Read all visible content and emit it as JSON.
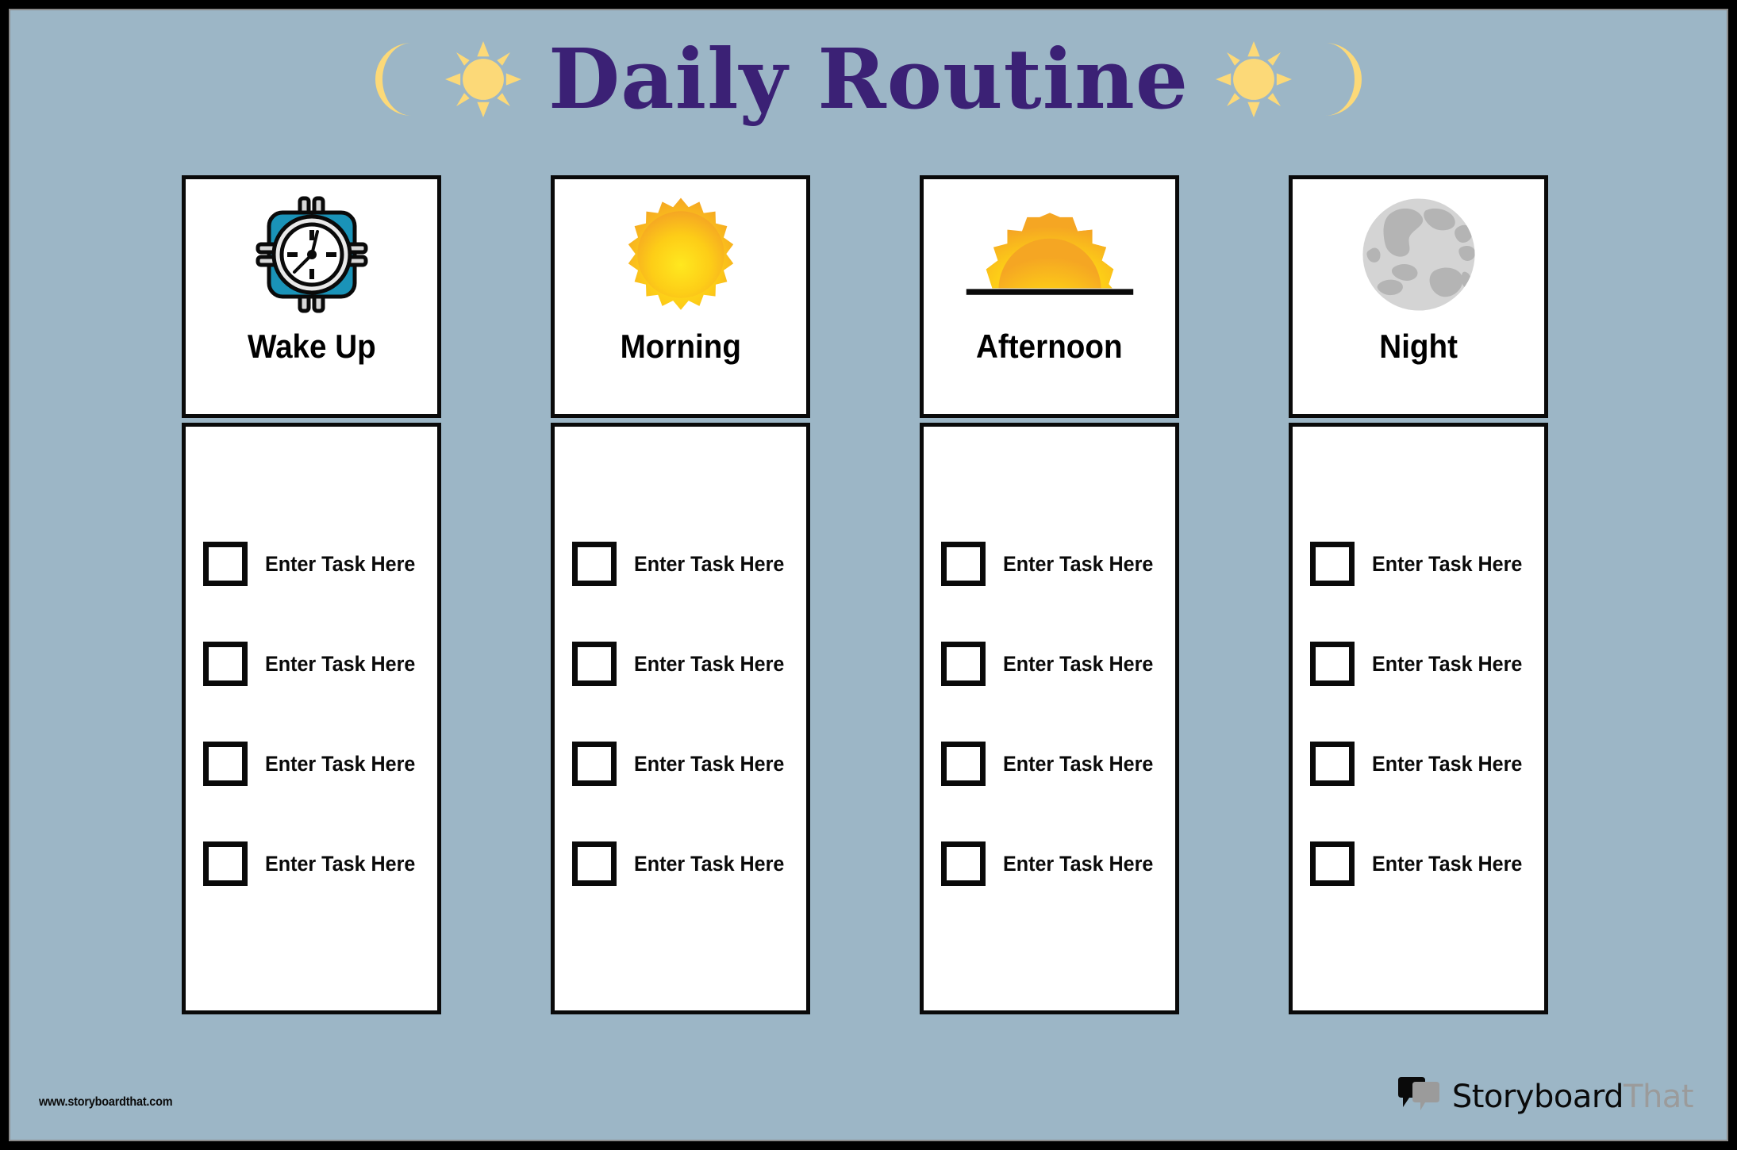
{
  "poster": {
    "title": "Daily Routine",
    "background_color": "#9cb6c6",
    "title_color": "#3b2175",
    "frame_color": "#000000",
    "decoration_color": "#fcd978",
    "decorations_left": [
      "crescent-moon",
      "sun"
    ],
    "decorations_right": [
      "sun",
      "crescent-moon"
    ]
  },
  "columns": [
    {
      "title": "Wake Up",
      "icon": "alarm-clock-icon",
      "icon_colors": {
        "body": "#1a93b8",
        "face": "#ffffff",
        "band": "#d8d8d8",
        "outline": "#0a0a0a"
      },
      "tasks": [
        {
          "label": "Enter Task Here",
          "checked": false
        },
        {
          "label": "Enter Task Here",
          "checked": false
        },
        {
          "label": "Enter Task Here",
          "checked": false
        },
        {
          "label": "Enter Task Here",
          "checked": false
        }
      ]
    },
    {
      "title": "Morning",
      "icon": "sun-icon",
      "icon_colors": {
        "inner": "#ffe81f",
        "outer": "#f5a623"
      },
      "tasks": [
        {
          "label": "Enter Task Here",
          "checked": false
        },
        {
          "label": "Enter Task Here",
          "checked": false
        },
        {
          "label": "Enter Task Here",
          "checked": false
        },
        {
          "label": "Enter Task Here",
          "checked": false
        }
      ]
    },
    {
      "title": "Afternoon",
      "icon": "sunset-icon",
      "icon_colors": {
        "inner": "#ffe81f",
        "outer": "#f5a623",
        "horizon": "#0a0a0a"
      },
      "tasks": [
        {
          "label": "Enter Task Here",
          "checked": false
        },
        {
          "label": "Enter Task Here",
          "checked": false
        },
        {
          "label": "Enter Task Here",
          "checked": false
        },
        {
          "label": "Enter Task Here",
          "checked": false
        }
      ]
    },
    {
      "title": "Night",
      "icon": "moon-icon",
      "icon_colors": {
        "surface": "#d4d4d4",
        "craters": "#b4b4b4"
      },
      "tasks": [
        {
          "label": "Enter Task Here",
          "checked": false
        },
        {
          "label": "Enter Task Here",
          "checked": false
        },
        {
          "label": "Enter Task Here",
          "checked": false
        },
        {
          "label": "Enter Task Here",
          "checked": false
        }
      ]
    }
  ],
  "footer": {
    "url": "www.storyboardthat.com",
    "brand_primary": "Storyboard",
    "brand_secondary": "That"
  }
}
